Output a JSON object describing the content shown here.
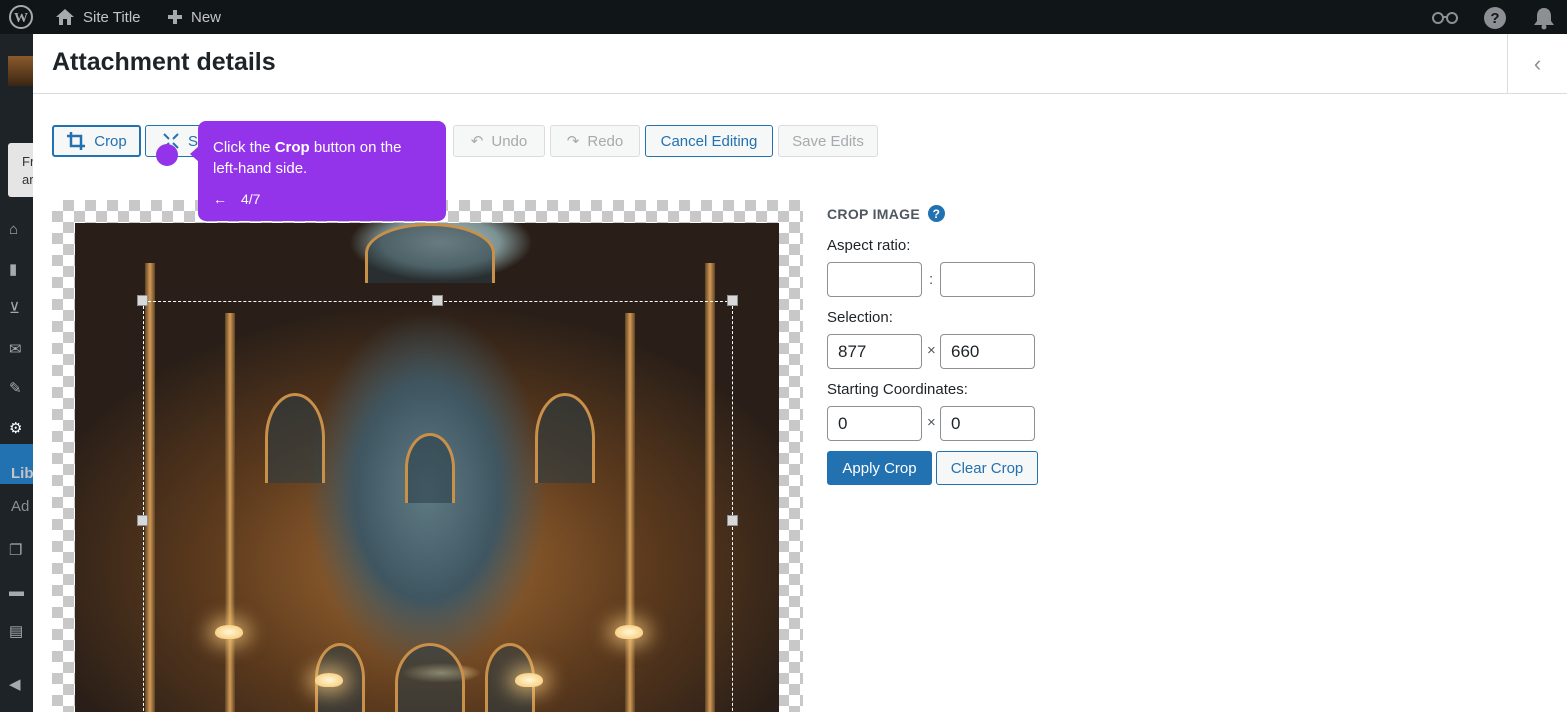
{
  "admin_bar": {
    "site_title": "Site Title",
    "new_label": "New"
  },
  "left_menu": {
    "notice_text": "Fr ar",
    "library_label": "Lib",
    "add_label": "Ad"
  },
  "modal": {
    "title": "Attachment details"
  },
  "toolbar": {
    "crop_label": "Crop",
    "scale_label": "S",
    "undo_label": "Undo",
    "redo_label": "Redo",
    "cancel_label": "Cancel Editing",
    "save_label": "Save Edits"
  },
  "tour": {
    "text_before": "Click the ",
    "text_bold": "Crop",
    "text_after": " button on the left-hand side.",
    "back_arrow": "←",
    "step": "4/7",
    "color": "#9333ea"
  },
  "crop_panel": {
    "heading": "CROP IMAGE",
    "help_icon_glyph": "?",
    "aspect_label": "Aspect ratio:",
    "aspect_sep": ":",
    "aspect_w": "",
    "aspect_h": "",
    "selection_label": "Selection:",
    "selection_sep": "×",
    "selection_w": "877",
    "selection_h": "660",
    "coords_label": "Starting Coordinates:",
    "coords_sep": "×",
    "coords_x": "0",
    "coords_y": "0",
    "apply_label": "Apply Crop",
    "clear_label": "Clear Crop"
  },
  "colors": {
    "accent": "#2271b1",
    "admin_bar": "#101517",
    "admin_menu": "#1d2327"
  }
}
